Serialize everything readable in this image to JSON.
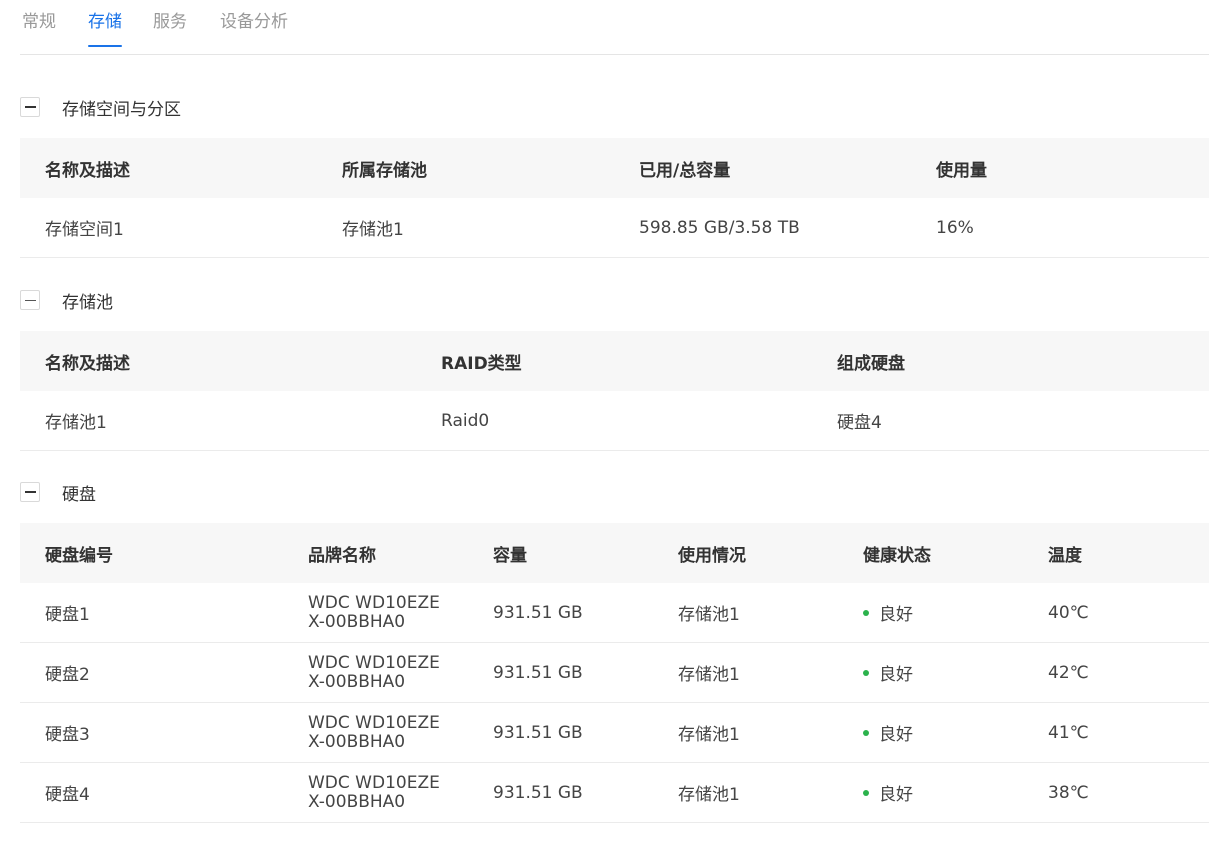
{
  "tabs": [
    {
      "label": "常规"
    },
    {
      "label": "存储"
    },
    {
      "label": "服务"
    },
    {
      "label": "设备分析"
    }
  ],
  "colors": {
    "accent": "#1a73e8",
    "healthy": "#2bb24c"
  },
  "space": {
    "title": "存储空间与分区",
    "headers": [
      "名称及描述",
      "所属存储池",
      "已用/总容量",
      "使用量"
    ],
    "rows": [
      {
        "name": "存储空间1",
        "pool": "存储池1",
        "capacity": "598.85 GB/3.58 TB",
        "usage": "16%"
      }
    ]
  },
  "pool": {
    "title": "存储池",
    "headers": [
      "名称及描述",
      "RAID类型",
      "组成硬盘"
    ],
    "rows": [
      {
        "name": "存储池1",
        "raid": "Raid0",
        "disks": "硬盘4"
      }
    ]
  },
  "disks": {
    "title": "硬盘",
    "headers": [
      "硬盘编号",
      "品牌名称",
      "容量",
      "使用情况",
      "健康状态",
      "温度"
    ],
    "rows": [
      {
        "id": "硬盘1",
        "brand_line1": "WDC WD10EZE",
        "brand_line2": "X-00BBHA0",
        "capacity": "931.51 GB",
        "usage": "存储池1",
        "health": "良好",
        "temp": "40℃"
      },
      {
        "id": "硬盘2",
        "brand_line1": "WDC WD10EZE",
        "brand_line2": "X-00BBHA0",
        "capacity": "931.51 GB",
        "usage": "存储池1",
        "health": "良好",
        "temp": "42℃"
      },
      {
        "id": "硬盘3",
        "brand_line1": "WDC WD10EZE",
        "brand_line2": "X-00BBHA0",
        "capacity": "931.51 GB",
        "usage": "存储池1",
        "health": "良好",
        "temp": "41℃"
      },
      {
        "id": "硬盘4",
        "brand_line1": "WDC WD10EZE",
        "brand_line2": "X-00BBHA0",
        "capacity": "931.51 GB",
        "usage": "存储池1",
        "health": "良好",
        "temp": "38℃"
      }
    ]
  }
}
